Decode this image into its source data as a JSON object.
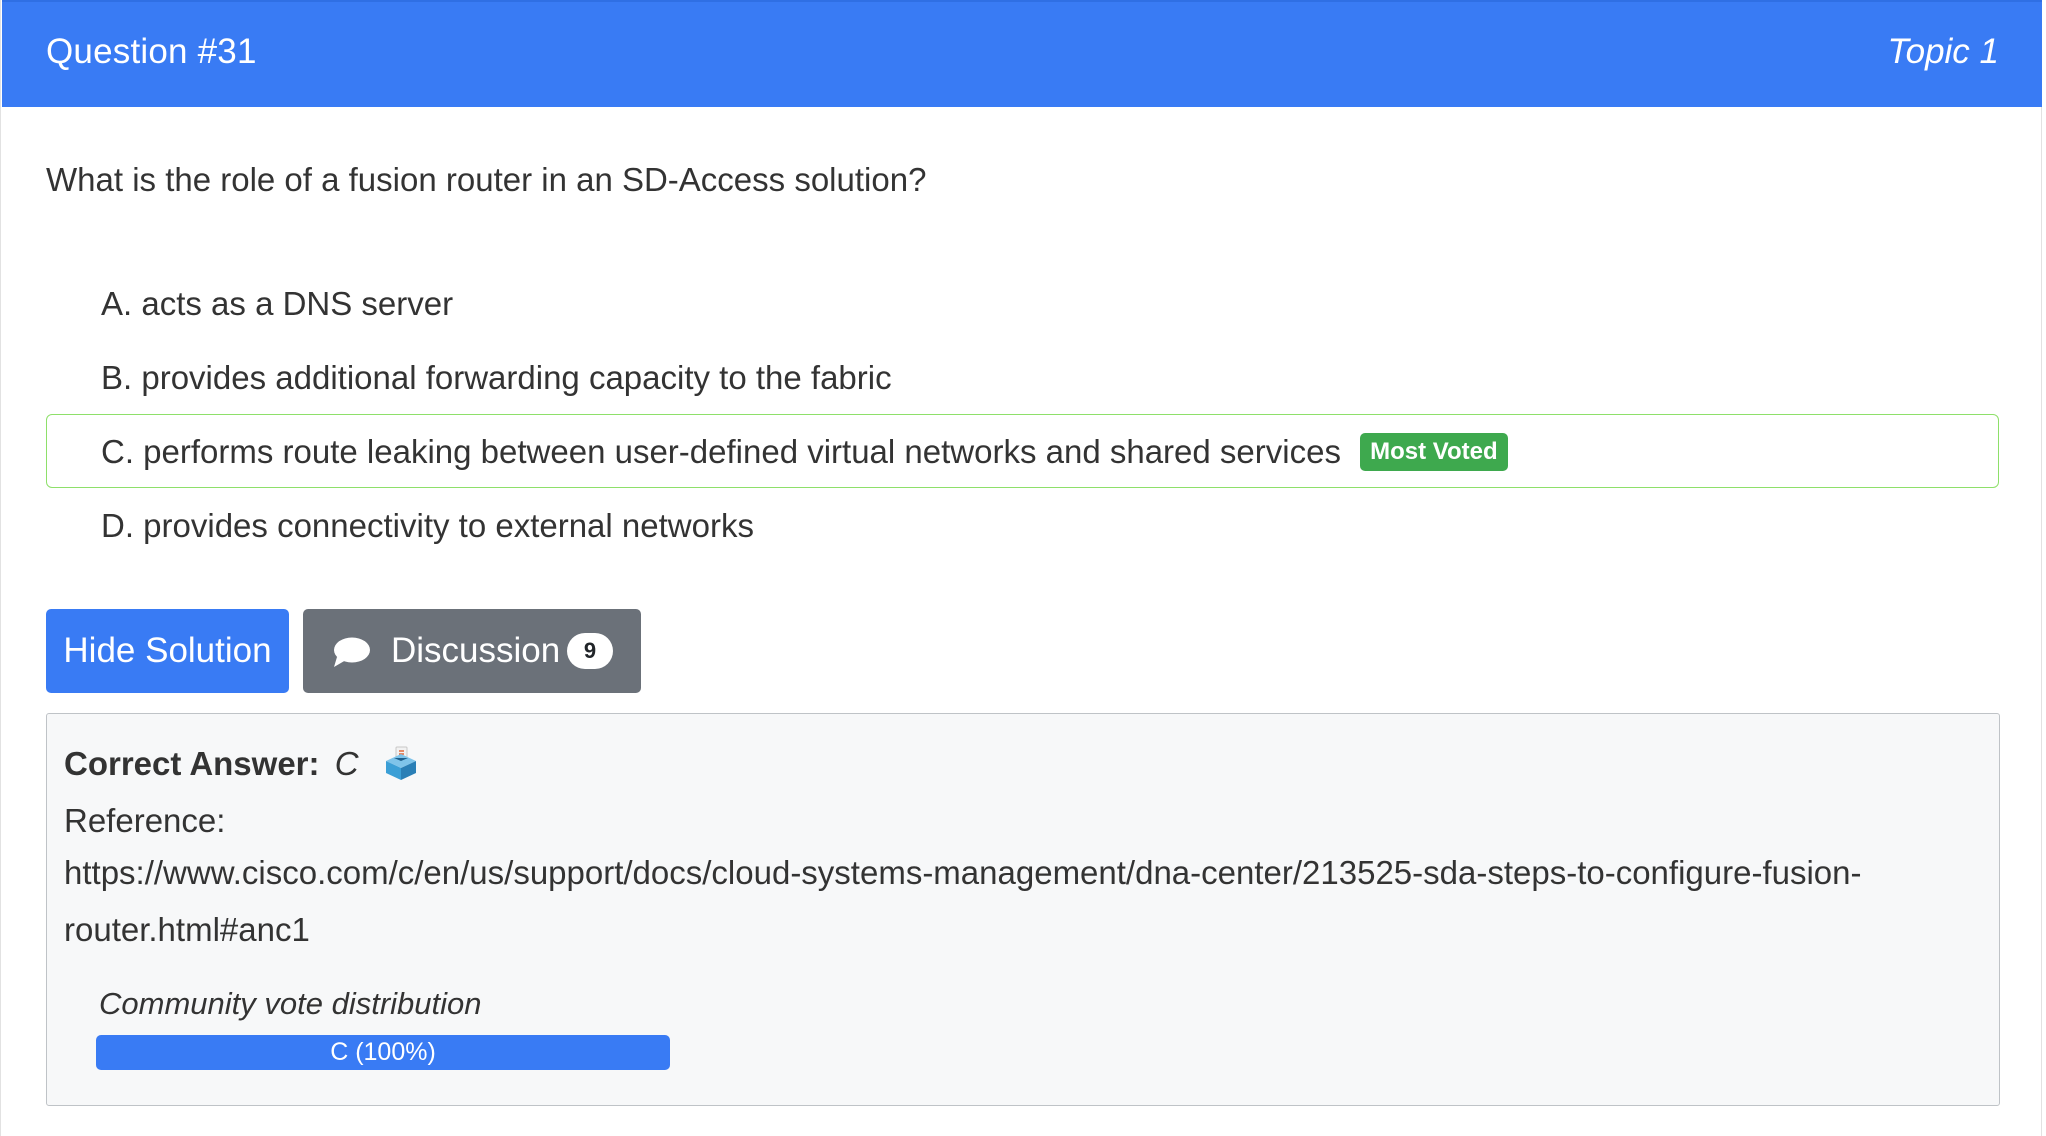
{
  "header": {
    "question_number": "Question #31",
    "topic": "Topic 1",
    "background_color": "#397bf4"
  },
  "question": {
    "text": "What is the role of a fusion router in an SD-Access solution?"
  },
  "choices": [
    {
      "letter": "A.",
      "text": "acts as a DNS server",
      "highlighted": false
    },
    {
      "letter": "B.",
      "text": "provides additional forwarding capacity to the fabric",
      "highlighted": false
    },
    {
      "letter": "C.",
      "text": "performs route leaking between user-defined virtual networks and shared services",
      "highlighted": true,
      "badge": "Most Voted"
    },
    {
      "letter": "D.",
      "text": "provides connectivity to external networks",
      "highlighted": false
    }
  ],
  "buttons": {
    "hide_solution": "Hide Solution",
    "discussion": "Discussion",
    "discussion_count": "9"
  },
  "answer": {
    "label": "Correct Answer:",
    "value": "C",
    "icon": "ballot-box-icon",
    "reference_label": "Reference:",
    "reference_url": "https://www.cisco.com/c/en/us/support/docs/cloud-systems-management/dna-center/213525-sda-steps-to-configure-fusion-router.html#anc1"
  },
  "votes": {
    "title": "Community vote distribution",
    "distribution": [
      {
        "label": "C (100%)",
        "percent": 100
      }
    ]
  },
  "colors": {
    "accent": "#397bf4",
    "badge_green": "#3ea94e",
    "highlight_border": "#8ee06a",
    "secondary_button": "#6b7179"
  }
}
